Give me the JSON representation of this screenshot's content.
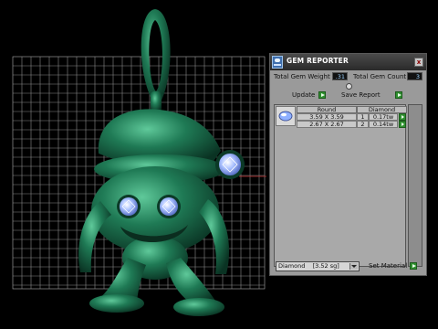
{
  "window": {
    "title": "GEM REPORTER",
    "close_glyph": "x"
  },
  "stats": {
    "weight_label": "Total Gem Weight",
    "weight_value": ".31",
    "count_label": "Total Gem Count",
    "count_value": "3"
  },
  "toolbar": {
    "update_label": "Update",
    "save_label": "Save Report"
  },
  "table": {
    "headers": [
      "Round",
      "Diamond"
    ],
    "rows": [
      {
        "size": "3.59 X 3.59",
        "count": "1",
        "weight": "0.17tw"
      },
      {
        "size": "2.67 X 2.67",
        "count": "2",
        "weight": "0.14tw"
      }
    ]
  },
  "material": {
    "selected": "Diamond    [3.52 sg]",
    "set_label": "Set Material"
  },
  "colors": {
    "model_green": "#1f7a55",
    "grid_gray": "#9a9a9a",
    "gem_blue": "#9fb8ff",
    "panel_gray": "#9a9a9a",
    "go_green": "#2f8f2f"
  },
  "icons": {
    "app": "gem-reporter-app-icon",
    "close": "close-icon",
    "collapse": "collapse-toggle-icon",
    "go": "play-arrow-icon",
    "gem": "round-gem-icon",
    "dropdown": "chevron-down-icon"
  }
}
